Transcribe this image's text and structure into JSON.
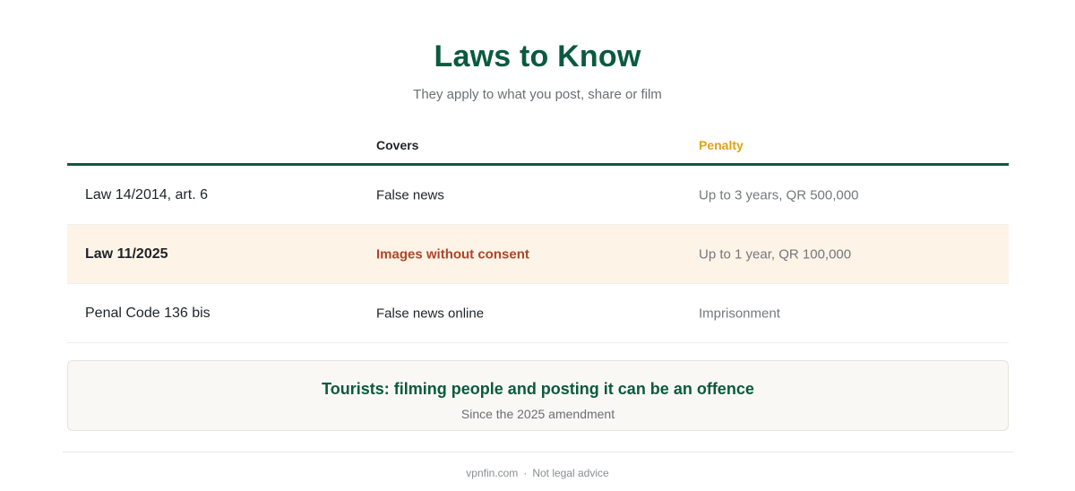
{
  "header": {
    "title": "Laws to Know",
    "subtitle": "They apply to what you post, share or film"
  },
  "table": {
    "columns": {
      "law": "",
      "covers": "Covers",
      "penalty": "Penalty"
    },
    "rows": [
      {
        "law": "Law 14/2014, art. 6",
        "covers": "False news",
        "penalty": "Up to 3 years, QR 500,000",
        "highlighted": false
      },
      {
        "law": "Law 11/2025",
        "covers": "Images without consent",
        "penalty": "Up to 1 year, QR 100,000",
        "highlighted": true
      },
      {
        "law": "Penal Code 136 bis",
        "covers": "False news online",
        "penalty": "Imprisonment",
        "highlighted": false
      }
    ]
  },
  "notice": {
    "title": "Tourists: filming people and posting it can be an offence",
    "subtitle": "Since the 2025 amendment"
  },
  "footer": {
    "site": "vpnfin.com",
    "separator": "·",
    "disclaimer": "Not legal advice"
  },
  "colors": {
    "brand_green": "#0b5a3f",
    "penalty_header": "#e0a21a",
    "highlight_text": "#b0452a",
    "highlight_row_bg": "#fdf3e6"
  }
}
